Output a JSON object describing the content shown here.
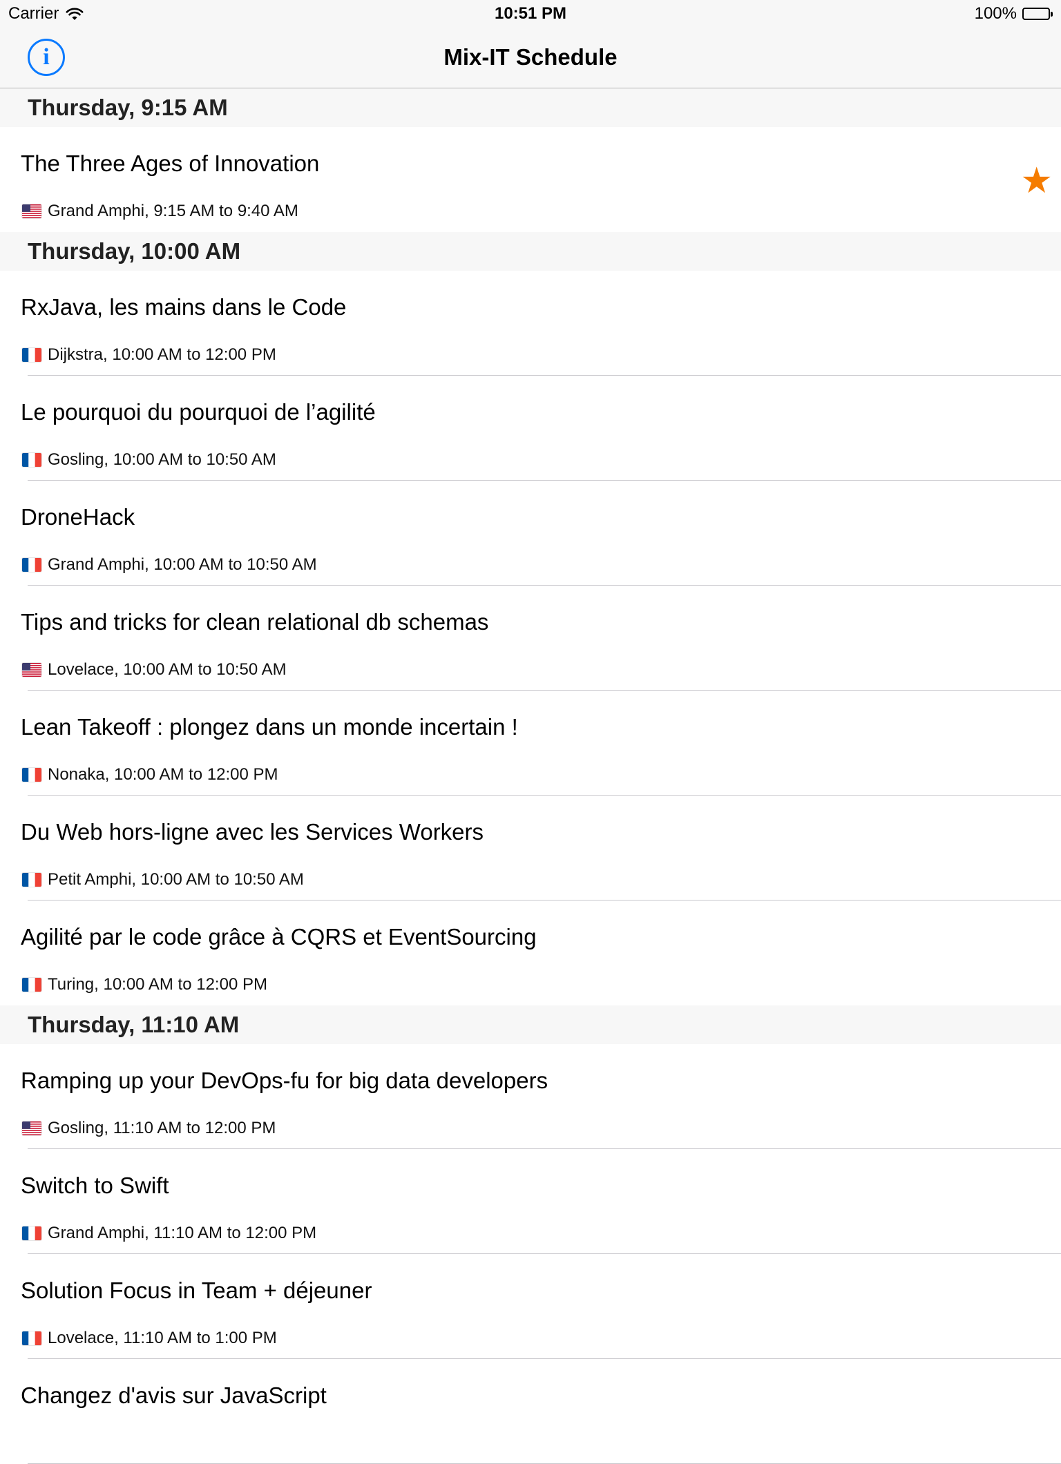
{
  "status_bar": {
    "carrier": "Carrier",
    "time": "10:51 PM",
    "battery": "100%"
  },
  "nav": {
    "title": "Mix-IT Schedule",
    "info_icon": "info-icon",
    "info_glyph": "i"
  },
  "colors": {
    "accent": "#0a7aff",
    "star": "#f57c00"
  },
  "sections": [
    {
      "header": "Thursday, 9:15 AM",
      "rows": [
        {
          "title": "The Three Ages of Innovation",
          "flag": "us",
          "meta": "Grand Amphi, 9:15 AM to 9:40 AM",
          "starred": true,
          "star_glyph": "★"
        }
      ]
    },
    {
      "header": "Thursday, 10:00 AM",
      "rows": [
        {
          "title": "RxJava, les mains dans le Code",
          "flag": "fr",
          "meta": "Dijkstra, 10:00 AM to 12:00 PM"
        },
        {
          "title": "Le pourquoi du pourquoi de l’agilité",
          "flag": "fr",
          "meta": "Gosling, 10:00 AM to 10:50 AM"
        },
        {
          "title": "DroneHack",
          "flag": "fr",
          "meta": "Grand Amphi, 10:00 AM to 10:50 AM"
        },
        {
          "title": "Tips and tricks for clean relational db schemas",
          "flag": "us",
          "meta": "Lovelace, 10:00 AM to 10:50 AM"
        },
        {
          "title": "Lean Takeoff : plongez dans un monde incertain !",
          "flag": "fr",
          "meta": "Nonaka, 10:00 AM to 12:00 PM"
        },
        {
          "title": "Du Web hors-ligne avec les Services Workers",
          "flag": "fr",
          "meta": "Petit Amphi, 10:00 AM to 10:50 AM"
        },
        {
          "title": "Agilité par le code grâce à CQRS et EventSourcing",
          "flag": "fr",
          "meta": "Turing, 10:00 AM to 12:00 PM"
        }
      ]
    },
    {
      "header": "Thursday, 11:10 AM",
      "rows": [
        {
          "title": "Ramping up your DevOps-fu for big data developers",
          "flag": "us",
          "meta": "Gosling, 11:10 AM to 12:00 PM"
        },
        {
          "title": "Switch to Swift",
          "flag": "fr",
          "meta": "Grand Amphi, 11:10 AM to 12:00 PM"
        },
        {
          "title": "Solution Focus in Team + déjeuner",
          "flag": "fr",
          "meta": "Lovelace, 11:10 AM to 1:00 PM"
        },
        {
          "title": "Changez d'avis sur JavaScript",
          "flag": "fr",
          "meta": ""
        }
      ]
    }
  ]
}
